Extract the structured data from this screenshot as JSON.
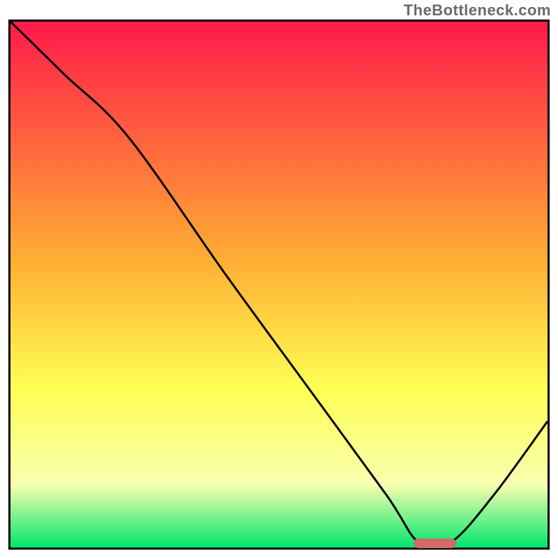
{
  "watermark": "TheBottleneck.com",
  "colors": {
    "gradient_top": "#ff1a4a",
    "gradient_mid1": "#ffad33",
    "gradient_mid2": "#ffff55",
    "gradient_mid3": "#f9ffb0",
    "gradient_bottom": "#00e66b",
    "curve": "#000000",
    "marker": "#d36a6a"
  },
  "chart_data": {
    "type": "line",
    "title": "",
    "xlabel": "",
    "ylabel": "",
    "xlim": [
      0,
      100
    ],
    "ylim": [
      0,
      100
    ],
    "grid": false,
    "series": [
      {
        "name": "bottleneck-curve",
        "x": [
          0,
          10,
          22,
          40,
          55,
          70,
          76,
          82,
          90,
          100
        ],
        "values": [
          100,
          90,
          78,
          52,
          31,
          10,
          1,
          1,
          10,
          24
        ]
      }
    ],
    "annotations": [
      {
        "name": "optimal-marker",
        "x_start": 75,
        "x_end": 83,
        "y": 0.8
      }
    ],
    "background_gradient": {
      "direction": "top-to-bottom",
      "stops": [
        {
          "pct": 0,
          "color": "#ff1a4a"
        },
        {
          "pct": 45,
          "color": "#ffad33"
        },
        {
          "pct": 70,
          "color": "#ffff55"
        },
        {
          "pct": 88,
          "color": "#f9ffb0"
        },
        {
          "pct": 100,
          "color": "#00e66b"
        }
      ]
    }
  }
}
